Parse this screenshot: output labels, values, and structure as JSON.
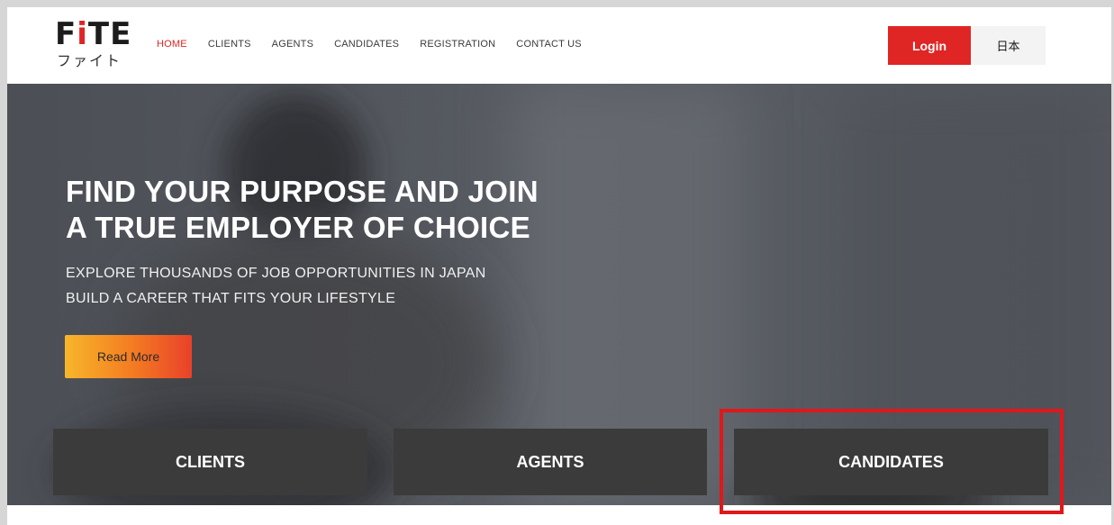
{
  "logo": {
    "main_prefix": "F",
    "main_accent": "i",
    "main_suffix": "TE",
    "sub": "ファイト"
  },
  "nav": {
    "items": [
      {
        "label": "HOME",
        "active": true
      },
      {
        "label": "CLIENTS",
        "active": false
      },
      {
        "label": "AGENTS",
        "active": false
      },
      {
        "label": "CANDIDATES",
        "active": false
      },
      {
        "label": "REGISTRATION",
        "active": false
      },
      {
        "label": "CONTACT US",
        "active": false
      }
    ]
  },
  "header": {
    "login_label": "Login",
    "language_label": "日本"
  },
  "hero": {
    "title_line1": "FIND YOUR PURPOSE AND JOIN",
    "title_line2": "A TRUE EMPLOYER OF CHOICE",
    "subtitle_line1": "EXPLORE THOUSANDS OF JOB OPPORTUNITIES IN JAPAN",
    "subtitle_line2": "BUILD A CAREER THAT FITS YOUR LIFESTYLE",
    "cta_label": "Read More"
  },
  "tiles": [
    {
      "label": "CLIENTS"
    },
    {
      "label": "AGENTS"
    },
    {
      "label": "CANDIDATES"
    }
  ],
  "colors": {
    "brand_red": "#e02525",
    "tile_bg": "#3b3b3b",
    "highlight": "#e0171b"
  }
}
